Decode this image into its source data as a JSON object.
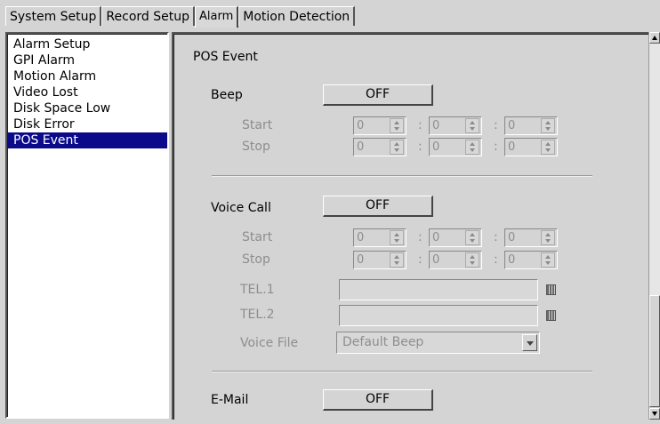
{
  "tabs": [
    "System Setup",
    "Record Setup",
    "Alarm",
    "Motion Detection"
  ],
  "active_tab": "Alarm",
  "sidebar": {
    "items": [
      "Alarm Setup",
      "GPI Alarm",
      "Motion Alarm",
      "Video Lost",
      "Disk Space Low",
      "Disk Error",
      "POS Event"
    ],
    "selected": "POS Event"
  },
  "main": {
    "title": "POS Event",
    "beep": {
      "label": "Beep",
      "toggle": "OFF",
      "start_label": "Start",
      "stop_label": "Stop",
      "start": [
        "0",
        "0",
        "0"
      ],
      "stop": [
        "0",
        "0",
        "0"
      ]
    },
    "voice_call": {
      "label": "Voice Call",
      "toggle": "OFF",
      "start_label": "Start",
      "stop_label": "Stop",
      "start": [
        "0",
        "0",
        "0"
      ],
      "stop": [
        "0",
        "0",
        "0"
      ],
      "tel1_label": "TEL.1",
      "tel1_value": "",
      "tel2_label": "TEL.2",
      "tel2_value": "",
      "voice_file_label": "Voice File",
      "voice_file_value": "Default Beep"
    },
    "email": {
      "label": "E-Mail",
      "toggle": "OFF"
    }
  },
  "colors": {
    "selection": "#0a0a8a",
    "disabled_text": "#8e8e8e",
    "panel_bg": "#d4d4d4"
  },
  "icons": [
    "scroll-up-arrow",
    "scroll-down-arrow",
    "spin-up-arrow",
    "spin-down-arrow",
    "keypad-icon",
    "dropdown-arrow"
  ]
}
